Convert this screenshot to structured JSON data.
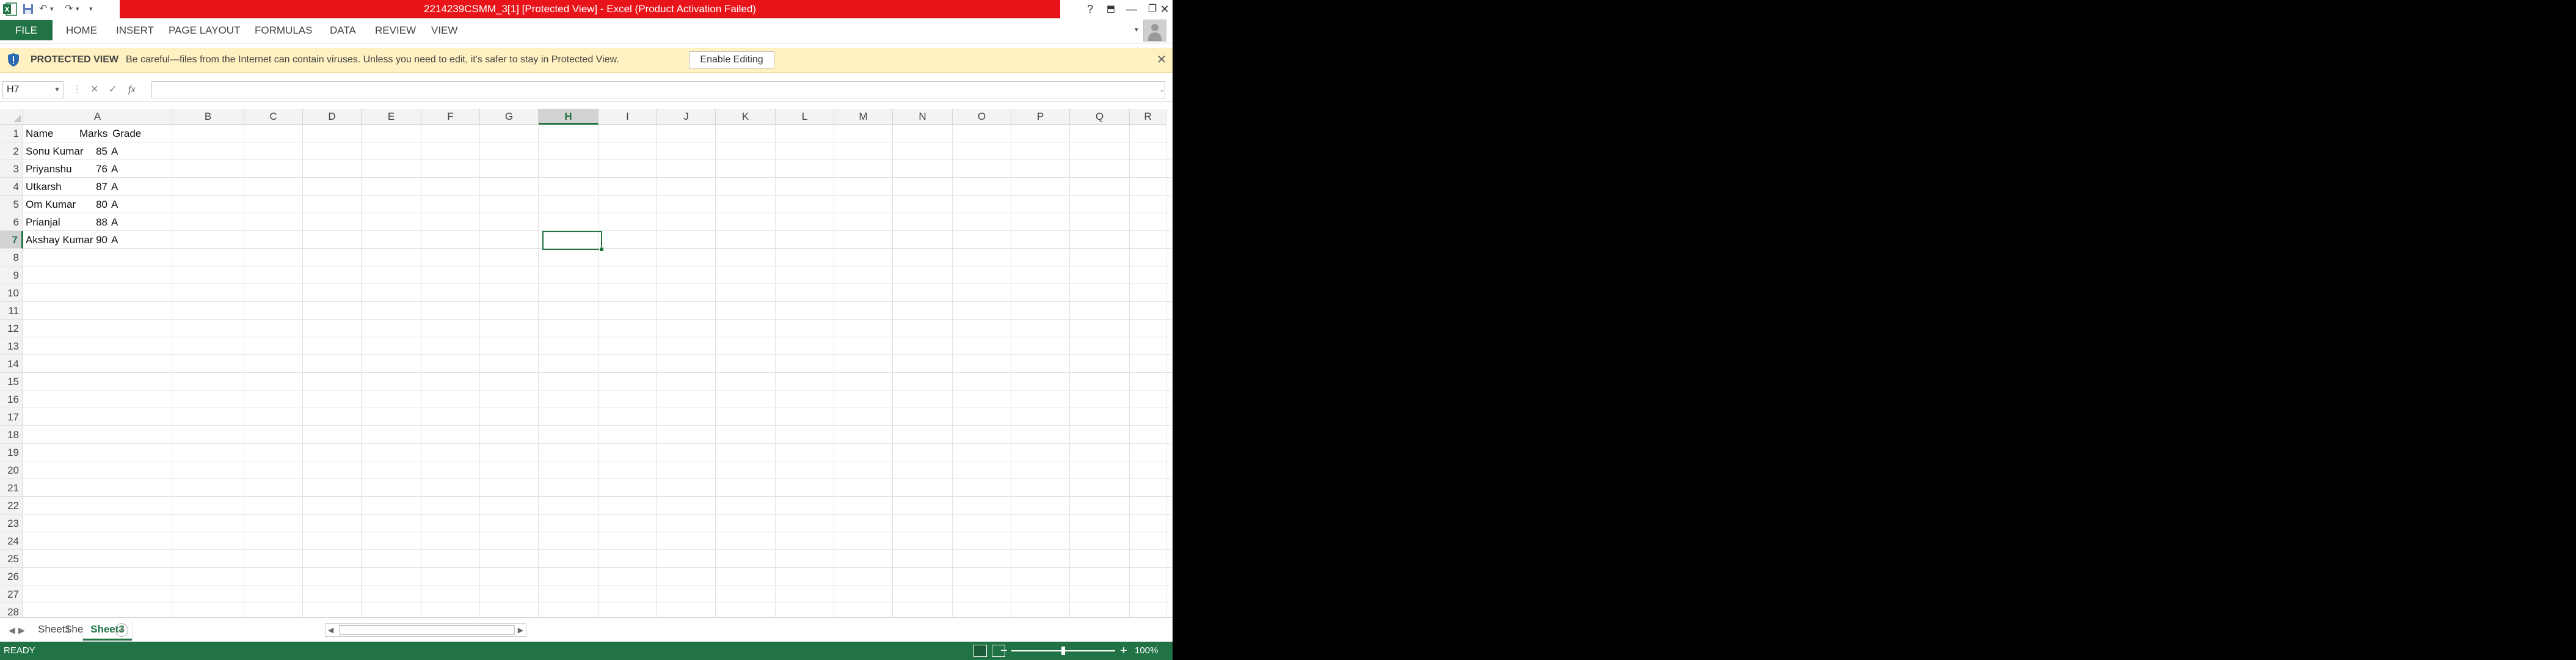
{
  "window": {
    "title": "2214239CSMM_3[1]  [Protected View] -  Excel (Product Activation Failed)",
    "controls": {
      "help": "?",
      "ribbon_options": "⬒",
      "minimize": "—",
      "restore": "❐",
      "close": "✕"
    }
  },
  "quick_access": {
    "undo": "↶",
    "redo": "↷",
    "more": "▾"
  },
  "ribbon": {
    "file_tab": "FILE",
    "tabs": [
      "HOME",
      "INSERT",
      "PAGE LAYOUT",
      "FORMULAS",
      "DATA",
      "REVIEW",
      "VIEW"
    ]
  },
  "protected_view": {
    "label": "PROTECTED VIEW",
    "message": "Be careful—files from the Internet can contain viruses. Unless you need to edit, it's safer to stay in Protected View.",
    "button": "Enable Editing",
    "close": "✕"
  },
  "formula_bar": {
    "name_box": "H7",
    "cancel": "✕",
    "enter": "✓",
    "fx": "fx",
    "value": ""
  },
  "sheet": {
    "columns": [
      "A",
      "B",
      "C",
      "D",
      "E",
      "F",
      "G",
      "H",
      "I",
      "J",
      "K",
      "L",
      "M",
      "N",
      "O",
      "P",
      "Q",
      "R"
    ],
    "rows": [
      "1",
      "2",
      "3",
      "4",
      "5",
      "6",
      "7",
      "8",
      "9",
      "10",
      "11",
      "12",
      "13",
      "14",
      "15",
      "16",
      "17",
      "18",
      "19",
      "20",
      "21",
      "22",
      "23",
      "24",
      "25",
      "26",
      "27",
      "28"
    ],
    "selected_cell": "H7",
    "headers": {
      "name": "Name",
      "marks": "Marks",
      "grade": "Grade"
    },
    "data": [
      {
        "name": "Sonu Kumar",
        "marks": "85",
        "grade": "A"
      },
      {
        "name": "Priyanshu",
        "marks": "76",
        "grade": "A"
      },
      {
        "name": "Utkarsh",
        "marks": "87",
        "grade": "A"
      },
      {
        "name": "Om Kumar",
        "marks": "80",
        "grade": "A"
      },
      {
        "name": "Prianjal",
        "marks": "88",
        "grade": "A"
      },
      {
        "name": "Akshay Kumar",
        "marks": "90",
        "grade": "A"
      }
    ]
  },
  "sheet_tabs": {
    "tabs": [
      "Sheet1",
      "Sheet2",
      "Sheet3"
    ],
    "active": "Sheet3",
    "add": "+",
    "nav_prev": "◀",
    "nav_next": "▶"
  },
  "status_bar": {
    "status": "READY",
    "zoom_minus": "−",
    "zoom_plus": "+",
    "zoom": "100%",
    "zoom_fraction": 0.5
  },
  "colors": {
    "excel_green": "#217346",
    "title_red": "#e8141a",
    "protected_yellow": "#fff1c1"
  }
}
